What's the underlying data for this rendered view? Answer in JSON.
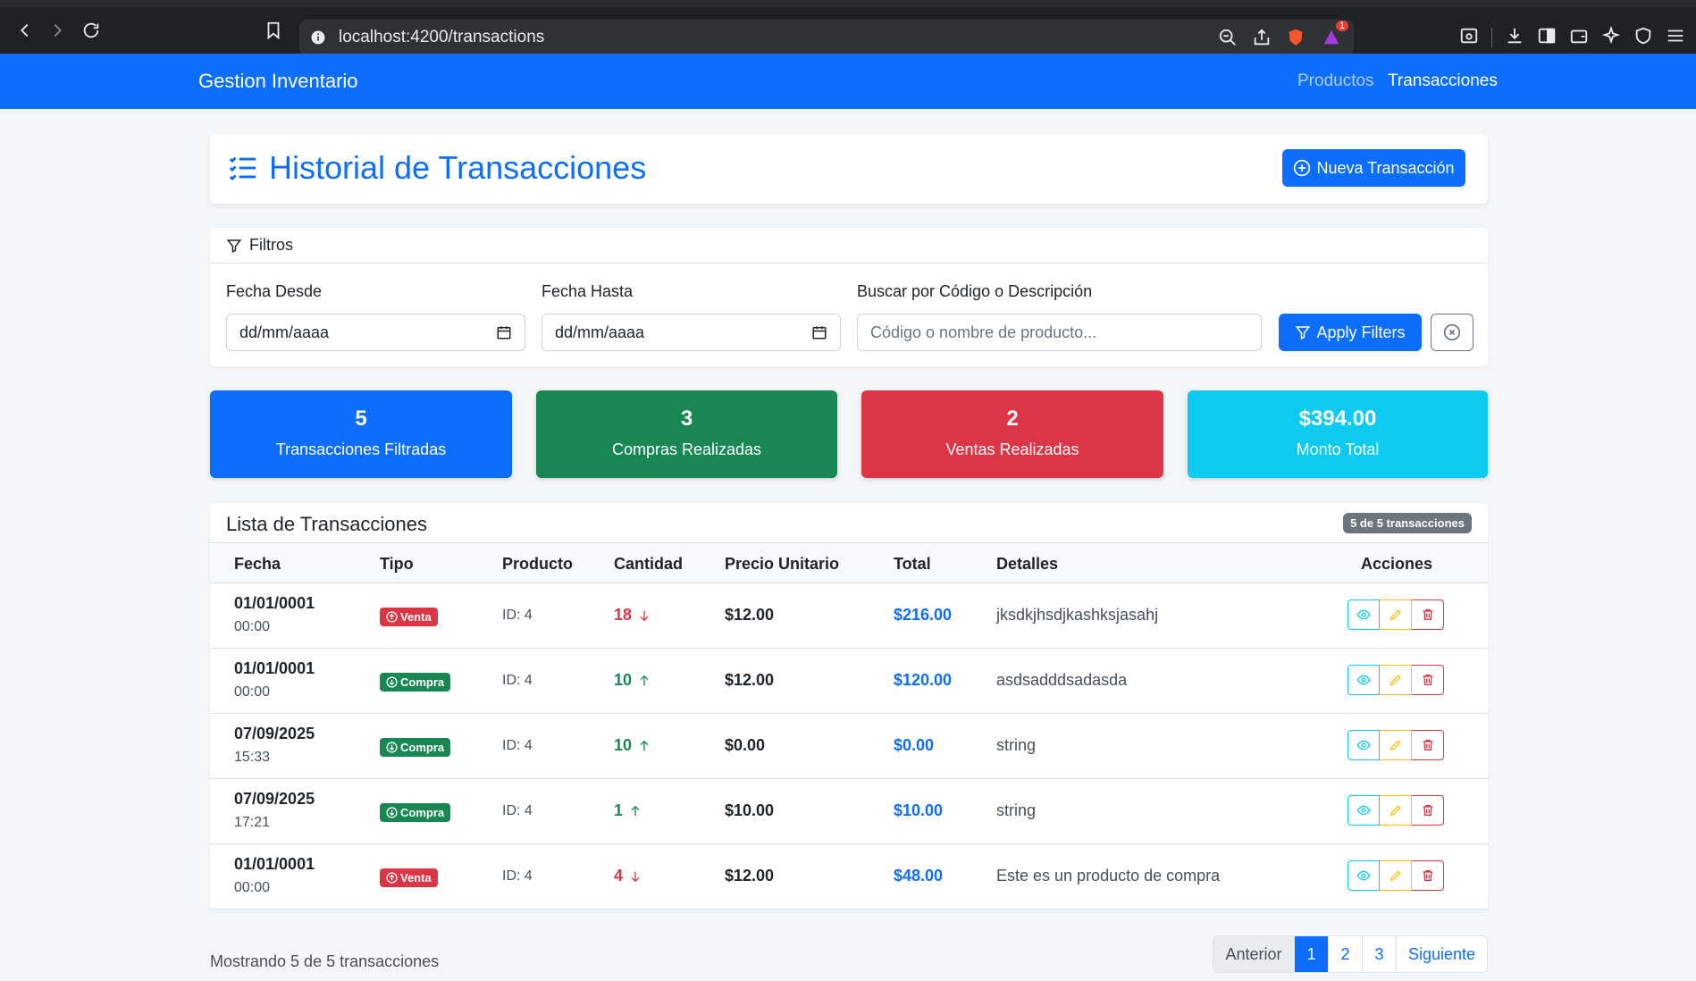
{
  "browser": {
    "url": "localhost:4200/transactions",
    "notification_count": "1"
  },
  "navbar": {
    "brand": "Gestion Inventario",
    "links": [
      {
        "label": "Productos"
      },
      {
        "label": "Transacciones"
      }
    ]
  },
  "header": {
    "title": "Historial de Transacciones",
    "new_button": "Nueva Transacción"
  },
  "filters": {
    "title": "Filtros",
    "date_from_label": "Fecha Desde",
    "date_from_value": "dd/mm/aaaa",
    "date_to_label": "Fecha Hasta",
    "date_to_value": "dd/mm/aaaa",
    "search_label": "Buscar por Código o Descripción",
    "search_placeholder": "Código o nombre de producto...",
    "apply_button": "Apply Filters"
  },
  "stats": [
    {
      "value": "5",
      "label": "Transacciones Filtradas",
      "color": "#0d6efd"
    },
    {
      "value": "3",
      "label": "Compras Realizadas",
      "color": "#198754"
    },
    {
      "value": "2",
      "label": "Ventas Realizadas",
      "color": "#dc3545"
    },
    {
      "value": "$394.00",
      "label": "Monto Total",
      "color": "#0dcaf0"
    }
  ],
  "table": {
    "title": "Lista de Transacciones",
    "count_badge": "5 de 5 transacciones",
    "headers": [
      "Fecha",
      "Tipo",
      "Producto",
      "Cantidad",
      "Precio Unitario",
      "Total",
      "Detalles",
      "Acciones"
    ],
    "rows": [
      {
        "date": "01/01/0001",
        "time": "00:00",
        "type": "Venta",
        "product": "ID: 4",
        "qty": "18",
        "price": "$12.00",
        "total": "$216.00",
        "details": "jksdkjhsdjkashksjasahj"
      },
      {
        "date": "01/01/0001",
        "time": "00:00",
        "type": "Compra",
        "product": "ID: 4",
        "qty": "10",
        "price": "$12.00",
        "total": "$120.00",
        "details": "asdsadddsadasda"
      },
      {
        "date": "07/09/2025",
        "time": "15:33",
        "type": "Compra",
        "product": "ID: 4",
        "qty": "10",
        "price": "$0.00",
        "total": "$0.00",
        "details": "string"
      },
      {
        "date": "07/09/2025",
        "time": "17:21",
        "type": "Compra",
        "product": "ID: 4",
        "qty": "1",
        "price": "$10.00",
        "total": "$10.00",
        "details": "string"
      },
      {
        "date": "01/01/0001",
        "time": "00:00",
        "type": "Venta",
        "product": "ID: 4",
        "qty": "4",
        "price": "$12.00",
        "total": "$48.00",
        "details": "Este es un producto de compra"
      }
    ]
  },
  "footer": {
    "showing": "Mostrando 5 de 5 transacciones",
    "pagination": [
      "Anterior",
      "1",
      "2",
      "3",
      "Siguiente"
    ]
  }
}
